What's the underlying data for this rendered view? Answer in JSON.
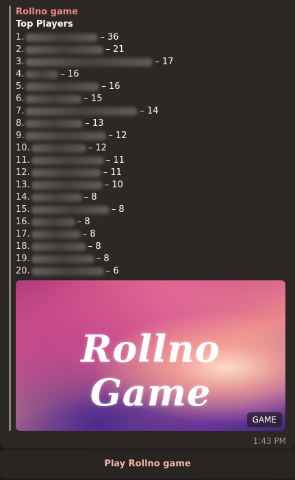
{
  "message": {
    "sender": "Rollno game",
    "heading": "Top Players",
    "time": "1:43 PM"
  },
  "leaderboard": [
    {
      "rank": "1.",
      "score": "– 36"
    },
    {
      "rank": "2.",
      "score": "– 21"
    },
    {
      "rank": "3.",
      "score": "– 17"
    },
    {
      "rank": "4.",
      "score": "– 16"
    },
    {
      "rank": "5.",
      "score": "– 16"
    },
    {
      "rank": "6.",
      "score": "– 15"
    },
    {
      "rank": "7.",
      "score": "– 14"
    },
    {
      "rank": "8.",
      "score": "– 13"
    },
    {
      "rank": "9.",
      "score": "– 12"
    },
    {
      "rank": "10.",
      "score": "– 12"
    },
    {
      "rank": "11.",
      "score": "– 11"
    },
    {
      "rank": "12.",
      "score": "– 11"
    },
    {
      "rank": "13.",
      "score": "– 10"
    },
    {
      "rank": "14.",
      "score": "– 8"
    },
    {
      "rank": "15.",
      "score": "– 8"
    },
    {
      "rank": "16.",
      "score": "– 8"
    },
    {
      "rank": "17.",
      "score": "– 8"
    },
    {
      "rank": "18.",
      "score": "– 8"
    },
    {
      "rank": "19.",
      "score": "– 8"
    },
    {
      "rank": "20.",
      "score": "– 6"
    }
  ],
  "game_card": {
    "title": "Rollno Game",
    "badge": "GAME"
  },
  "keyboard": {
    "play_button": "Play Rollno game"
  },
  "colors": {
    "sender": "#f0848c",
    "button_text": "#f0b8a8"
  }
}
